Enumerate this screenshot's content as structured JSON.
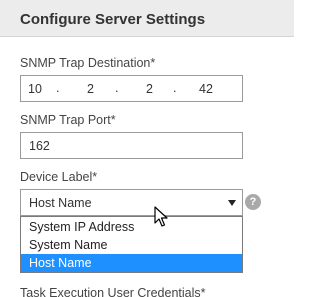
{
  "dialog": {
    "title": "Configure Server Settings"
  },
  "form": {
    "snmp_trap_destination": {
      "label": "SNMP Trap Destination*",
      "octets": [
        "10",
        "2",
        "2",
        "42"
      ],
      "dot": "."
    },
    "snmp_trap_port": {
      "label": "SNMP Trap Port*",
      "value": "162"
    },
    "device_label": {
      "label": "Device Label*",
      "selected": "Host Name",
      "options": [
        "System IP Address",
        "System Name",
        "Host Name"
      ],
      "help_icon": "question-mark-icon",
      "help_glyph": "?"
    },
    "task_execution_credentials": {
      "label": "Task Execution User Credentials*"
    }
  },
  "colors": {
    "header_bg": "#ececec",
    "selected_option_bg": "#1e90ff",
    "help_icon_bg": "#a9a9a9"
  }
}
